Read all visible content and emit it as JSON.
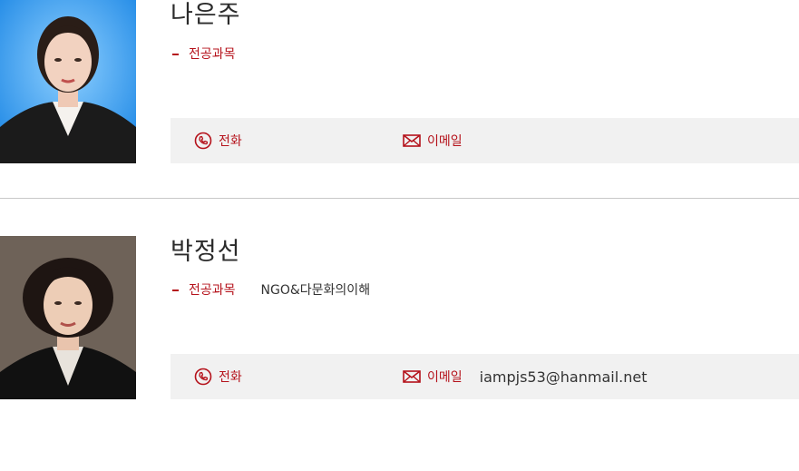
{
  "faculty": [
    {
      "name": "나은주",
      "subject_label": "전공과목",
      "subject_value": "",
      "phone_label": "전화",
      "phone_value": "",
      "email_label": "이메일",
      "email_value": "",
      "photo_bg": "#3aa0f0"
    },
    {
      "name": "박정선",
      "subject_label": "전공과목",
      "subject_value": "NGO&다문화의이해",
      "phone_label": "전화",
      "phone_value": "",
      "email_label": "이메일",
      "email_value": "iampjs53@hanmail.net",
      "photo_bg": "#6e6258"
    }
  ],
  "colors": {
    "accent": "#b5121b",
    "bar": "#f1f1f1",
    "divider": "#c8c8c8"
  },
  "icons": {
    "phone": "phone-icon",
    "email": "envelope-icon"
  }
}
